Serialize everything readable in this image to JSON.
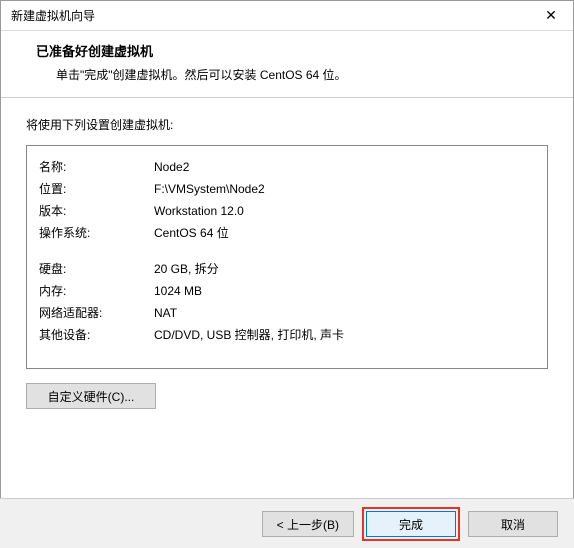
{
  "window": {
    "title": "新建虚拟机向导"
  },
  "header": {
    "heading": "已准备好创建虚拟机",
    "subheading": "单击\"完成\"创建虚拟机。然后可以安装 CentOS 64 位。"
  },
  "content": {
    "intro": "将使用下列设置创建虚拟机:",
    "rows": [
      {
        "label": "名称:",
        "value": "Node2"
      },
      {
        "label": "位置:",
        "value": "F:\\VMSystem\\Node2"
      },
      {
        "label": "版本:",
        "value": "Workstation 12.0"
      },
      {
        "label": "操作系统:",
        "value": "CentOS 64 位"
      }
    ],
    "rows2": [
      {
        "label": "硬盘:",
        "value": "20 GB, 拆分"
      },
      {
        "label": "内存:",
        "value": "1024 MB"
      },
      {
        "label": "网络适配器:",
        "value": "NAT"
      },
      {
        "label": "其他设备:",
        "value": "CD/DVD, USB 控制器, 打印机, 声卡"
      }
    ],
    "customize_btn": "自定义硬件(C)..."
  },
  "footer": {
    "back": "< 上一步(B)",
    "finish": "完成",
    "cancel": "取消"
  }
}
